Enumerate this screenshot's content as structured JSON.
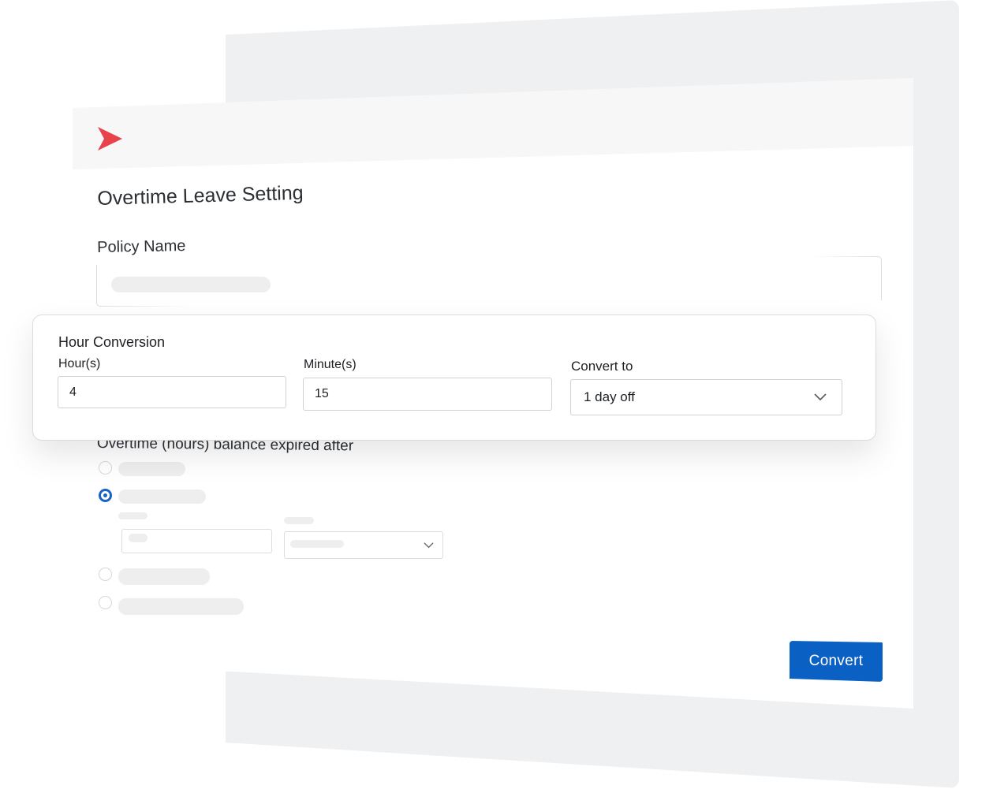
{
  "page": {
    "title": "Overtime Leave Setting"
  },
  "policy": {
    "label": "Policy Name"
  },
  "hour_conversion": {
    "title": "Hour Conversion",
    "hours_label": "Hour(s)",
    "hours_value": "4",
    "minutes_label": "Minute(s)",
    "minutes_value": "15",
    "convert_to_label": "Convert to",
    "convert_to_value": "1 day off"
  },
  "expiry": {
    "title": "Overtime (hours) balance expired after",
    "selected_option_index": 1
  },
  "actions": {
    "convert_label": "Convert"
  },
  "colors": {
    "brand_red": "#e8424a",
    "primary_blue": "#0b60c4",
    "radio_blue": "#1863c6"
  },
  "icons": {
    "logo": "brand-chevron-logo",
    "dropdown": "chevron-down-icon"
  }
}
